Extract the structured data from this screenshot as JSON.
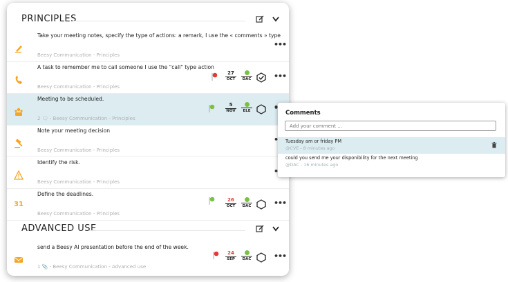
{
  "sections": {
    "principles": {
      "title": "PRINCIPLES"
    },
    "advanced": {
      "title": "ADVANCED USE"
    }
  },
  "rows": [
    {
      "icon": "pencil-icon",
      "title": "Take your meeting notes, specify the type of actions: a remark, I use the « comments » type",
      "subtitle": "Beesy Communication - Principles"
    },
    {
      "icon": "phone-icon",
      "title": "A task to remember me to call someone I use the \"call\" type action",
      "subtitle": "Beesy Communication - Principles",
      "flag_color": "#e53935",
      "date_day": "27",
      "date_month": "OCT",
      "date_color": "#222222",
      "user": "DAC"
    },
    {
      "icon": "meeting-icon",
      "title": "Meeting to be scheduled.",
      "subtitle": "2 🗨 - Beesy Communication - Principles",
      "flag_color": "#7ac143",
      "date_day": "5",
      "date_month": "NOV",
      "date_color": "#222222",
      "user": "ELE"
    },
    {
      "icon": "gavel-icon",
      "title": "Note your meeting decision",
      "subtitle": "Beesy Communication - Principles"
    },
    {
      "icon": "warning-icon",
      "title": "Identify the risk.",
      "subtitle": "Beesy Communication - Principles"
    },
    {
      "icon": "calendar-31-icon",
      "icon_text": "31",
      "title": "Define the deadlines.",
      "subtitle": "Beesy Communication - Principles",
      "flag_color": "#7ac143",
      "date_day": "26",
      "date_month": "OCT",
      "date_color": "#e53935",
      "user": "DAC"
    },
    {
      "icon": "envelope-icon",
      "title": "send a Beesy AI presentation before the end of the week.",
      "subtitle": "1 📎 - Beesy Communication - Advanced use",
      "flag_color": "#e53935",
      "date_day": "24",
      "date_month": "SEP",
      "date_color": "#e53935",
      "user": "DAC"
    }
  ],
  "comments_panel": {
    "title": "Comments",
    "placeholder": "Add your comment ...",
    "comments": [
      {
        "text": "Tuesday am or friday PM",
        "meta": "@CVE - 8 minutes ago"
      },
      {
        "text": "could you send me your disponibility for the next meeting",
        "meta": "@DAC - 16 minutes ago"
      }
    ]
  },
  "colors": {
    "accent_orange": "#f5a623",
    "selected_row": "#dcecf1",
    "green": "#7ac143",
    "red": "#e53935"
  }
}
